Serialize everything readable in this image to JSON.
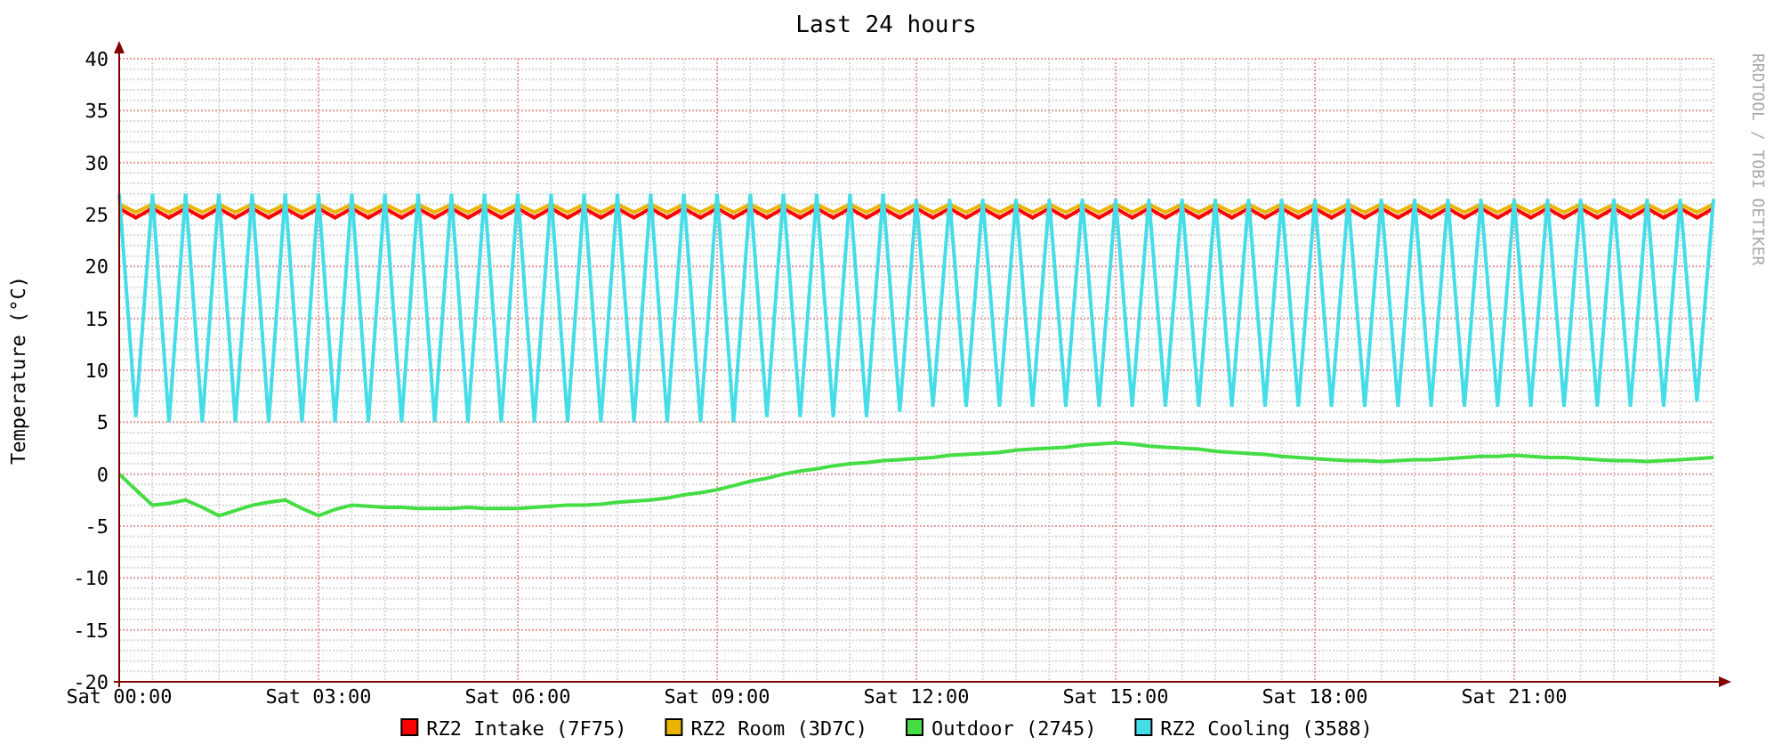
{
  "chart_data": {
    "type": "line",
    "grid": true,
    "legend": "bottom",
    "title": "Last 24 hours",
    "ylabel": "Temperature (°C)",
    "ylim": [
      -20,
      40
    ],
    "yticks": [
      -20,
      -15,
      -10,
      -5,
      0,
      5,
      10,
      15,
      20,
      25,
      30,
      35,
      40
    ],
    "categories": [
      "Sat 00:00",
      null,
      null,
      null,
      null,
      null,
      null,
      null,
      null,
      null,
      null,
      null,
      "Sat 03:00",
      null,
      null,
      null,
      null,
      null,
      null,
      null,
      null,
      null,
      null,
      null,
      "Sat 06:00",
      null,
      null,
      null,
      null,
      null,
      null,
      null,
      null,
      null,
      null,
      null,
      "Sat 09:00",
      null,
      null,
      null,
      null,
      null,
      null,
      null,
      null,
      null,
      null,
      null,
      "Sat 12:00",
      null,
      null,
      null,
      null,
      null,
      null,
      null,
      null,
      null,
      null,
      null,
      "Sat 15:00",
      null,
      null,
      null,
      null,
      null,
      null,
      null,
      null,
      null,
      null,
      null,
      "Sat 18:00",
      null,
      null,
      null,
      null,
      null,
      null,
      null,
      null,
      null,
      null,
      null,
      "Sat 21:00",
      null,
      null,
      null,
      null,
      null,
      null,
      null,
      null,
      null,
      null,
      null,
      null
    ],
    "series": [
      {
        "name": "RZ2 Intake (7F75)",
        "color": "#ff0000",
        "values": [
          25.6,
          24.7,
          25.6,
          24.7,
          25.6,
          24.7,
          25.6,
          24.7,
          25.6,
          24.7,
          25.6,
          24.7,
          25.6,
          24.7,
          25.6,
          24.7,
          25.6,
          24.7,
          25.6,
          24.7,
          25.6,
          24.7,
          25.6,
          24.7,
          25.6,
          24.7,
          25.6,
          24.7,
          25.6,
          24.7,
          25.6,
          24.7,
          25.6,
          24.7,
          25.6,
          24.7,
          25.6,
          24.7,
          25.6,
          24.7,
          25.6,
          24.7,
          25.6,
          24.7,
          25.6,
          24.7,
          25.6,
          24.7,
          25.6,
          24.7,
          25.6,
          24.7,
          25.6,
          24.7,
          25.6,
          24.7,
          25.6,
          24.7,
          25.6,
          24.7,
          25.6,
          24.7,
          25.6,
          24.7,
          25.6,
          24.7,
          25.6,
          24.7,
          25.6,
          24.7,
          25.6,
          24.7,
          25.6,
          24.7,
          25.6,
          24.7,
          25.6,
          24.7,
          25.6,
          24.7,
          25.6,
          24.7,
          25.6,
          24.7,
          25.6,
          24.7,
          25.6,
          24.7,
          25.6,
          24.7,
          25.6,
          24.7,
          25.6,
          24.7,
          25.6,
          24.7,
          25.6
        ]
      },
      {
        "name": "RZ2 Room (3D7C)",
        "color": "#e8b400",
        "values": [
          26,
          25.2,
          26,
          25.2,
          26,
          25.2,
          26,
          25.2,
          26,
          25.2,
          26,
          25.2,
          26,
          25.2,
          26,
          25.2,
          26,
          25.2,
          26,
          25.2,
          26,
          25.2,
          26,
          25.2,
          26,
          25.2,
          26,
          25.2,
          26,
          25.2,
          26,
          25.2,
          26,
          25.2,
          26,
          25.2,
          26,
          25.2,
          26,
          25.2,
          26,
          25.2,
          26,
          25.2,
          26,
          25.2,
          26,
          25.2,
          26,
          25.2,
          26,
          25.2,
          26,
          25.2,
          26,
          25.2,
          26,
          25.2,
          26,
          25.2,
          26,
          25.2,
          26,
          25.2,
          26,
          25.2,
          26,
          25.2,
          26,
          25.2,
          26,
          25.2,
          26,
          25.2,
          26,
          25.2,
          26,
          25.2,
          26,
          25.2,
          26,
          25.2,
          26,
          25.2,
          26,
          25.2,
          26,
          25.2,
          26,
          25.2,
          26,
          25.2,
          26,
          25.2,
          26,
          25.2,
          26
        ]
      },
      {
        "name": "Outdoor (2745)",
        "color": "#44dd44",
        "values": [
          0,
          -1.5,
          -3,
          -2.8,
          -2.5,
          -3.2,
          -4,
          -3.5,
          -3,
          -2.7,
          -2.5,
          -3.3,
          -4,
          -3.4,
          -3,
          -3.1,
          -3.2,
          -3.2,
          -3.3,
          -3.3,
          -3.3,
          -3.2,
          -3.3,
          -3.3,
          -3.3,
          -3.2,
          -3.1,
          -3,
          -3,
          -2.9,
          -2.7,
          -2.6,
          -2.5,
          -2.3,
          -2,
          -1.8,
          -1.5,
          -1.1,
          -0.7,
          -0.4,
          0,
          0.3,
          0.5,
          0.8,
          1,
          1.1,
          1.3,
          1.4,
          1.5,
          1.6,
          1.8,
          1.9,
          2,
          2.1,
          2.3,
          2.4,
          2.5,
          2.6,
          2.8,
          2.9,
          3,
          2.9,
          2.7,
          2.6,
          2.5,
          2.4,
          2.2,
          2.1,
          2,
          1.9,
          1.7,
          1.6,
          1.5,
          1.4,
          1.3,
          1.3,
          1.2,
          1.3,
          1.4,
          1.4,
          1.5,
          1.6,
          1.7,
          1.7,
          1.8,
          1.7,
          1.6,
          1.6,
          1.5,
          1.4,
          1.3,
          1.3,
          1.2,
          1.3,
          1.4,
          1.5,
          1.6
        ]
      },
      {
        "name": "RZ2 Cooling (3588)",
        "color": "#44dde8",
        "values": [
          27,
          5.5,
          27,
          5,
          27,
          5,
          27,
          5,
          27,
          5,
          27,
          5,
          27,
          5,
          27,
          5,
          27,
          5,
          27,
          5,
          27,
          5,
          27,
          5,
          27,
          5,
          27,
          5,
          27,
          5,
          27,
          5,
          27,
          5,
          27,
          5,
          27,
          5,
          27,
          5.5,
          27,
          5.5,
          27,
          5.5,
          27,
          5.5,
          27,
          6,
          26.5,
          6.5,
          26.5,
          6.5,
          26.5,
          6.5,
          26.5,
          6.5,
          26.5,
          6.5,
          26.5,
          6.5,
          26.5,
          6.5,
          26.5,
          6.5,
          26.5,
          6.5,
          26.5,
          6.5,
          26.5,
          6.5,
          26.5,
          6.5,
          26.5,
          6.5,
          26.5,
          6.5,
          26.5,
          6.5,
          26.5,
          6.5,
          26.5,
          6.5,
          26.5,
          6.5,
          26.5,
          6.5,
          26.5,
          6.5,
          26.5,
          6.5,
          26.5,
          6.5,
          26.5,
          6.5,
          26.5,
          7,
          26.5
        ]
      }
    ]
  },
  "credit": "RRDTOOL / TOBI OETIKER"
}
